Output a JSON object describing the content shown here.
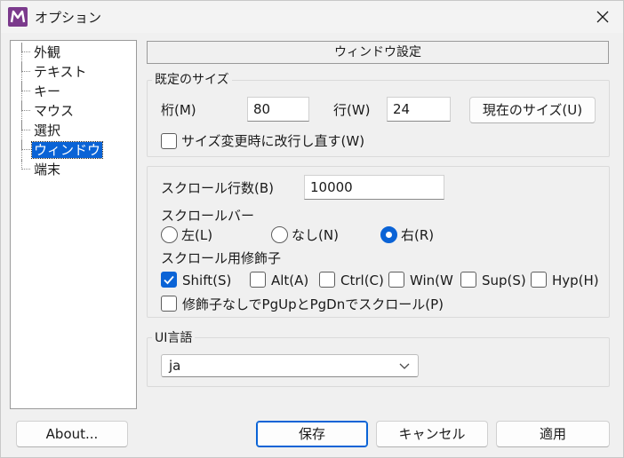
{
  "window": {
    "title": "オプション"
  },
  "tree": {
    "items": [
      {
        "label": "外観",
        "selected": false
      },
      {
        "label": "テキスト",
        "selected": false
      },
      {
        "label": "キー",
        "selected": false
      },
      {
        "label": "マウス",
        "selected": false
      },
      {
        "label": "選択",
        "selected": false
      },
      {
        "label": "ウィンドウ",
        "selected": true
      },
      {
        "label": "端末",
        "selected": false
      }
    ]
  },
  "section": {
    "title": "ウィンドウ設定"
  },
  "size_group": {
    "legend": "既定のサイズ",
    "cols_label": "桁(M)",
    "cols_value": "80",
    "rows_label": "行(W)",
    "rows_value": "24",
    "current_size_button": "現在のサイズ(U)",
    "reflow_checkbox": {
      "label": "サイズ変更時に改行し直す(W)",
      "checked": false
    }
  },
  "scroll_group": {
    "lines_label": "スクロール行数(B)",
    "lines_value": "10000",
    "scrollbar_label": "スクロールバー",
    "scrollbar_options": [
      {
        "label": "左(L)",
        "checked": false
      },
      {
        "label": "なし(N)",
        "checked": false
      },
      {
        "label": "右(R)",
        "checked": true
      }
    ],
    "modifier_label": "スクロール用修飾子",
    "modifiers": [
      {
        "label": "Shift(S)",
        "checked": true
      },
      {
        "label": "Alt(A)",
        "checked": false
      },
      {
        "label": "Ctrl(C)",
        "checked": false
      },
      {
        "label": "Win(W",
        "checked": false
      },
      {
        "label": "Sup(S)",
        "checked": false
      },
      {
        "label": "Hyp(H)",
        "checked": false
      }
    ],
    "pgupdn_checkbox": {
      "label": "修飾子なしでPgUpとPgDnでスクロール(P)",
      "checked": false
    }
  },
  "ui_lang_group": {
    "legend": "UI言語",
    "selected": "ja"
  },
  "footer": {
    "about": "About...",
    "save": "保存",
    "cancel": "キャンセル",
    "apply": "適用"
  },
  "colors": {
    "accent": "#0a63d6",
    "logo": "#7b3a8c"
  }
}
